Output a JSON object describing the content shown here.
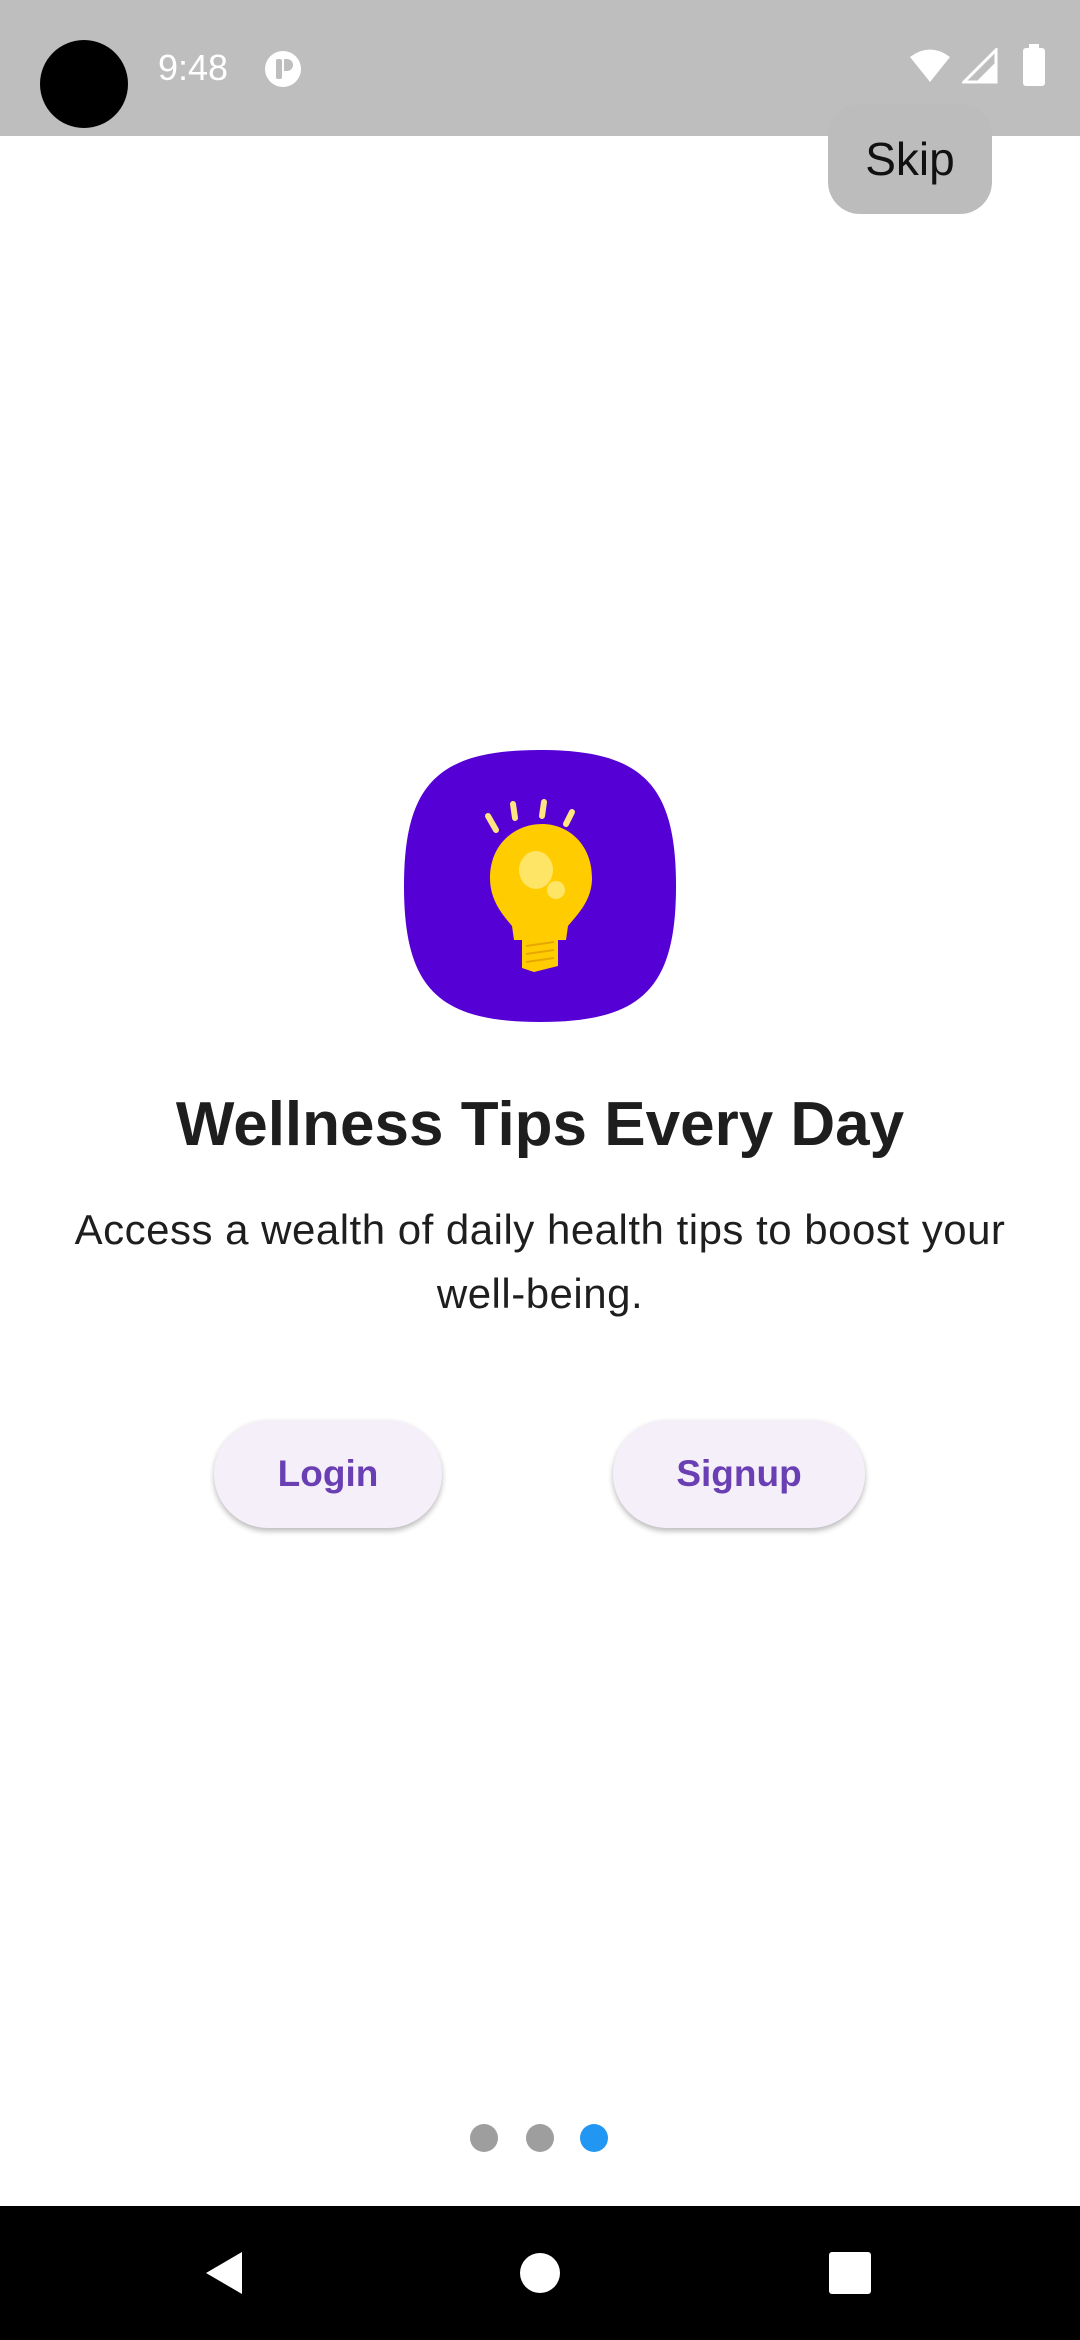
{
  "status_bar": {
    "time": "9:48",
    "icons": [
      "camera-cutout",
      "notification-icon",
      "wifi-icon",
      "cellular-signal-icon",
      "battery-icon"
    ]
  },
  "skip": {
    "label": "Skip"
  },
  "onboarding": {
    "icon": "lightbulb-icon",
    "title": "Wellness Tips Every Day",
    "description": "Access a wealth of daily health tips to boost your well-being.",
    "login_label": "Login",
    "signup_label": "Signup",
    "page_indicator": {
      "total": 3,
      "current": 3
    }
  },
  "nav_bar": {
    "icons": [
      "back-icon",
      "home-icon",
      "recents-icon"
    ]
  },
  "colors": {
    "status_bar_bg": "#bebebe",
    "icon_bg": "#5500d5",
    "bulb": "#ffcc00",
    "button_text": "#6a3fb3",
    "button_bg": "#f5eff9",
    "indicator_active": "#2196f3",
    "indicator_inactive": "#9e9e9e"
  }
}
